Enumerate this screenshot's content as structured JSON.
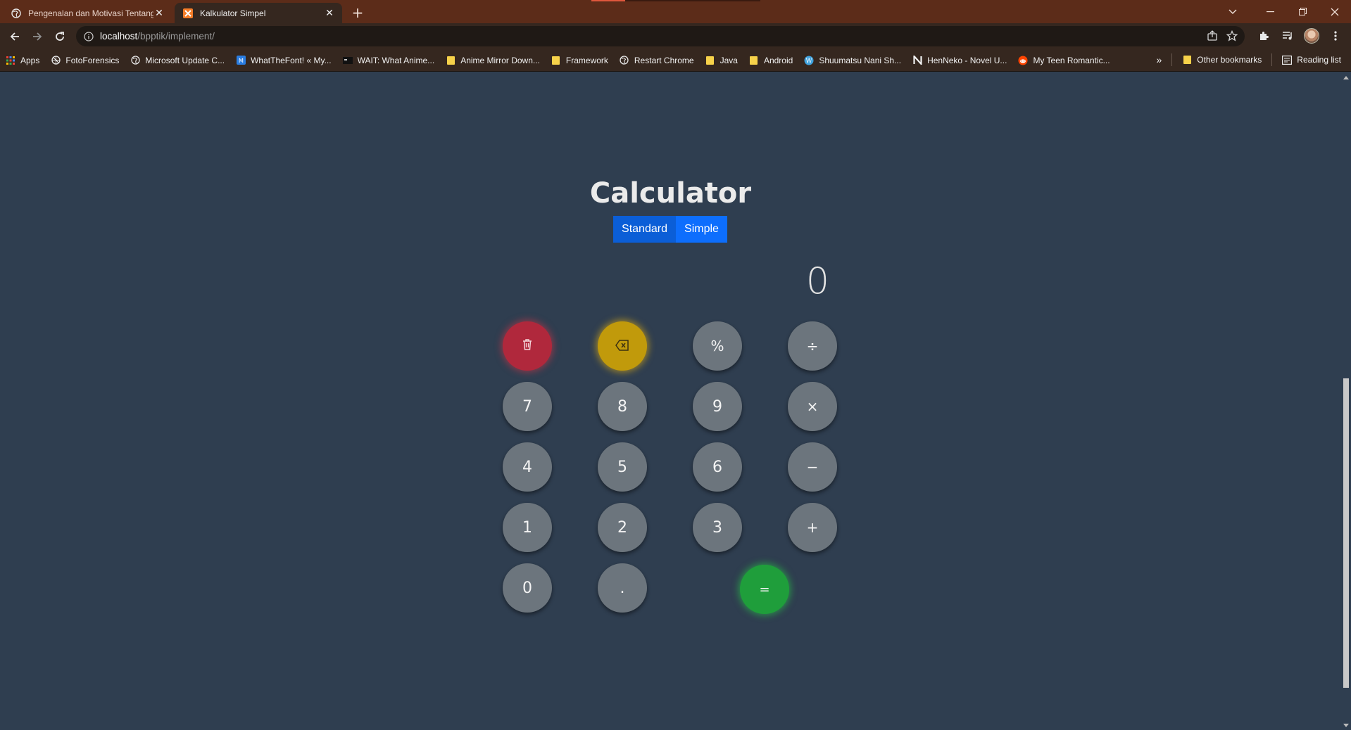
{
  "browser": {
    "tabs": [
      {
        "title": "Pengenalan dan Motivasi Tentang",
        "active": false
      },
      {
        "title": "Kalkulator Simpel",
        "active": true
      }
    ],
    "url_host": "localhost",
    "url_path": "/bpptik/implement/",
    "bookmarks": [
      {
        "label": "Apps",
        "icon": "apps-grid-icon"
      },
      {
        "label": "FotoForensics",
        "icon": "fotoforensics-icon"
      },
      {
        "label": "Microsoft Update C...",
        "icon": "globe-icon"
      },
      {
        "label": "WhatTheFont! « My...",
        "icon": "myfonts-icon"
      },
      {
        "label": "WAIT: What Anime...",
        "icon": "wait-icon"
      },
      {
        "label": "Anime Mirror Down...",
        "icon": "folder-icon"
      },
      {
        "label": "Framework",
        "icon": "folder-icon"
      },
      {
        "label": "Restart Chrome",
        "icon": "globe-icon"
      },
      {
        "label": "Java",
        "icon": "folder-icon"
      },
      {
        "label": "Android",
        "icon": "folder-icon"
      },
      {
        "label": "Shuumatsu Nani Sh...",
        "icon": "wordpress-icon"
      },
      {
        "label": "HenNeko - Novel U...",
        "icon": "henneko-icon"
      },
      {
        "label": "My Teen Romantic...",
        "icon": "reddit-icon"
      }
    ],
    "overflow_label": "»",
    "other_bookmarks": "Other bookmarks",
    "reading_list": "Reading list"
  },
  "calculator": {
    "title": "Calculator",
    "modes": [
      "Standard",
      "Simple"
    ],
    "display_value": "0",
    "keys": {
      "clear_icon": "trash-icon",
      "backspace_icon": "backspace-icon",
      "percent": "%",
      "divide": "÷",
      "seven": "7",
      "eight": "8",
      "nine": "9",
      "multiply": "×",
      "four": "4",
      "five": "5",
      "six": "6",
      "minus": "−",
      "one": "1",
      "two": "2",
      "three": "3",
      "plus": "+",
      "zero": "0",
      "dot": ".",
      "equals": "="
    }
  },
  "colors": {
    "page_bg": "#2f3e50",
    "key_gray": "#6c757d",
    "clear_red": "#b0283c",
    "backspace_yellow": "#c19a0b",
    "equals_green": "#1f9e3b",
    "mode_blue": "#0d6efd"
  }
}
